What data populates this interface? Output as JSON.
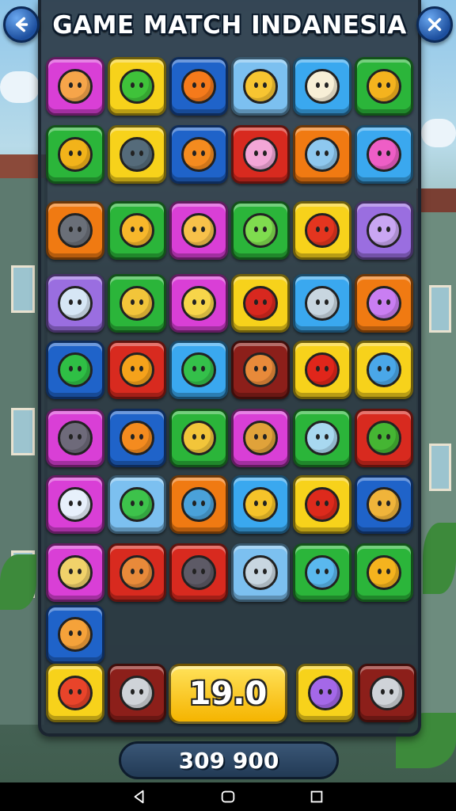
{
  "title": "GAME MATCH INDANESIA",
  "counter": "19.0",
  "score": "309 900",
  "colors": {
    "magenta": "#d93fd6",
    "yellow": "#f7d21b",
    "blue": "#1f63c9",
    "lightblue": "#7cc0f0",
    "green": "#2bb53a",
    "orange": "#f07a12",
    "red": "#d82a1f",
    "purple": "#9a6ee0",
    "darkred": "#8c1f1a",
    "skyblue": "#3aa8ef"
  },
  "tiles": [
    {
      "icon": "star-face-icon",
      "bg": "magenta",
      "fg": "#f6a54a"
    },
    {
      "icon": "spiky-ball-icon",
      "bg": "yellow",
      "fg": "#3fc23a"
    },
    {
      "icon": "ring-icon",
      "bg": "blue",
      "fg": "#f57a1b"
    },
    {
      "icon": "spinning-top-icon",
      "bg": "lightblue",
      "fg": "#f7c531"
    },
    {
      "icon": "llama-face-icon",
      "bg": "skyblue",
      "fg": "#f7efd6"
    },
    {
      "icon": "golden-bar-icon",
      "bg": "green",
      "fg": "#f4b31e"
    },
    {
      "icon": "hammer-icon",
      "bg": "green",
      "fg": "#f2b31a"
    },
    {
      "icon": "crossed-tools-icon",
      "bg": "yellow",
      "fg": "#556b7a"
    },
    {
      "icon": "sun-face-icon",
      "bg": "blue",
      "fg": "#f48b1f"
    },
    {
      "icon": "pig-face-icon",
      "bg": "red",
      "fg": "#f3a6d7"
    },
    {
      "icon": "robot-face-icon",
      "bg": "orange",
      "fg": "#8ec8ef"
    },
    {
      "icon": "sun-face-pink-icon",
      "bg": "skyblue",
      "fg": "#ee5ec6"
    },
    {
      "icon": "knight-figure-icon",
      "bg": "orange",
      "fg": "#6a6f78"
    },
    {
      "icon": "chat-bubble-face-icon",
      "bg": "green",
      "fg": "#f7b72b"
    },
    {
      "icon": "fox-face-icon",
      "bg": "magenta",
      "fg": "#f7c14a"
    },
    {
      "icon": "goblin-face-icon",
      "bg": "green",
      "fg": "#7fdc4f"
    },
    {
      "icon": "sun-red-face-icon",
      "bg": "yellow",
      "fg": "#e4351f"
    },
    {
      "icon": "cat-bust-icon",
      "bg": "purple",
      "fg": "#c9a6f2"
    },
    {
      "icon": "gumball-jar-icon",
      "bg": "purple",
      "fg": "#d6e6f5"
    },
    {
      "icon": "crossed-feathers-icon",
      "bg": "green",
      "fg": "#f2c53a"
    },
    {
      "icon": "duck-figure-icon",
      "bg": "magenta",
      "fg": "#f7d54a"
    },
    {
      "icon": "red-drop-icon",
      "bg": "yellow",
      "fg": "#d8281f"
    },
    {
      "icon": "arcade-machine-icon",
      "bg": "skyblue",
      "fg": "#c8d6e0"
    },
    {
      "icon": "popsicle-icon",
      "bg": "orange",
      "fg": "#c97ef2"
    },
    {
      "icon": "green-spiky-ball-icon",
      "bg": "blue",
      "fg": "#2fbf45"
    },
    {
      "icon": "orange-swirl-icon",
      "bg": "red",
      "fg": "#f5a21b"
    },
    {
      "icon": "green-drop-face-icon",
      "bg": "skyblue",
      "fg": "#34c04a"
    },
    {
      "icon": "battery-icon",
      "bg": "darkred",
      "fg": "#e88a3a"
    },
    {
      "icon": "red-hook-icon",
      "bg": "yellow",
      "fg": "#e0261b"
    },
    {
      "icon": "vase-icon",
      "bg": "yellow",
      "fg": "#4aa7e8"
    },
    {
      "icon": "grey-cat-face-icon",
      "bg": "magenta",
      "fg": "#6e6a7a"
    },
    {
      "icon": "sun-face-icon",
      "bg": "blue",
      "fg": "#f48b1f"
    },
    {
      "icon": "crossed-feathers-icon",
      "bg": "green",
      "fg": "#f2c53a"
    },
    {
      "icon": "sword-icon",
      "bg": "magenta",
      "fg": "#e0a23a"
    },
    {
      "icon": "light-blue-bar-icon",
      "bg": "green",
      "fg": "#a8d8f0"
    },
    {
      "icon": "green-pot-icon",
      "bg": "red",
      "fg": "#45b533"
    },
    {
      "icon": "robot-bunny-icon",
      "bg": "magenta",
      "fg": "#e7f0fb"
    },
    {
      "icon": "green-chat-face-icon",
      "bg": "lightblue",
      "fg": "#3dc24b"
    },
    {
      "icon": "blue-cat-face-icon",
      "bg": "orange",
      "fg": "#4aa1d9"
    },
    {
      "icon": "lion-face-icon",
      "bg": "skyblue",
      "fg": "#f5c32a"
    },
    {
      "icon": "red-cone-icon",
      "bg": "yellow",
      "fg": "#dd2a1c"
    },
    {
      "icon": "crossed-swords-icon",
      "bg": "blue",
      "fg": "#f0b43a"
    },
    {
      "icon": "dagger-icon",
      "bg": "magenta",
      "fg": "#f0d26a"
    },
    {
      "icon": "battery-icon",
      "bg": "red",
      "fg": "#e88a3a"
    },
    {
      "icon": "grey-cat-face-icon",
      "bg": "red",
      "fg": "#5d5a66"
    },
    {
      "icon": "arcade-machine-icon",
      "bg": "lightblue",
      "fg": "#c8d6e0"
    },
    {
      "icon": "blue-balloon-icon",
      "bg": "green",
      "fg": "#5ab8ee"
    },
    {
      "icon": "golden-bar-icon",
      "bg": "green",
      "fg": "#f4b31e"
    },
    {
      "icon": "fox-face-icon",
      "bg": "blue",
      "fg": "#f5a23a"
    }
  ],
  "bottom_tiles": [
    {
      "icon": "flame-creature-icon",
      "bg": "yellow",
      "fg": "#e8442a"
    },
    {
      "icon": "dagger-icon",
      "bg": "darkred",
      "fg": "#cfd3d8"
    },
    {
      "icon": "purple-chat-face-icon",
      "bg": "yellow",
      "fg": "#a468e8"
    },
    {
      "icon": "dagger-icon",
      "bg": "darkred",
      "fg": "#cfd3d8"
    }
  ]
}
